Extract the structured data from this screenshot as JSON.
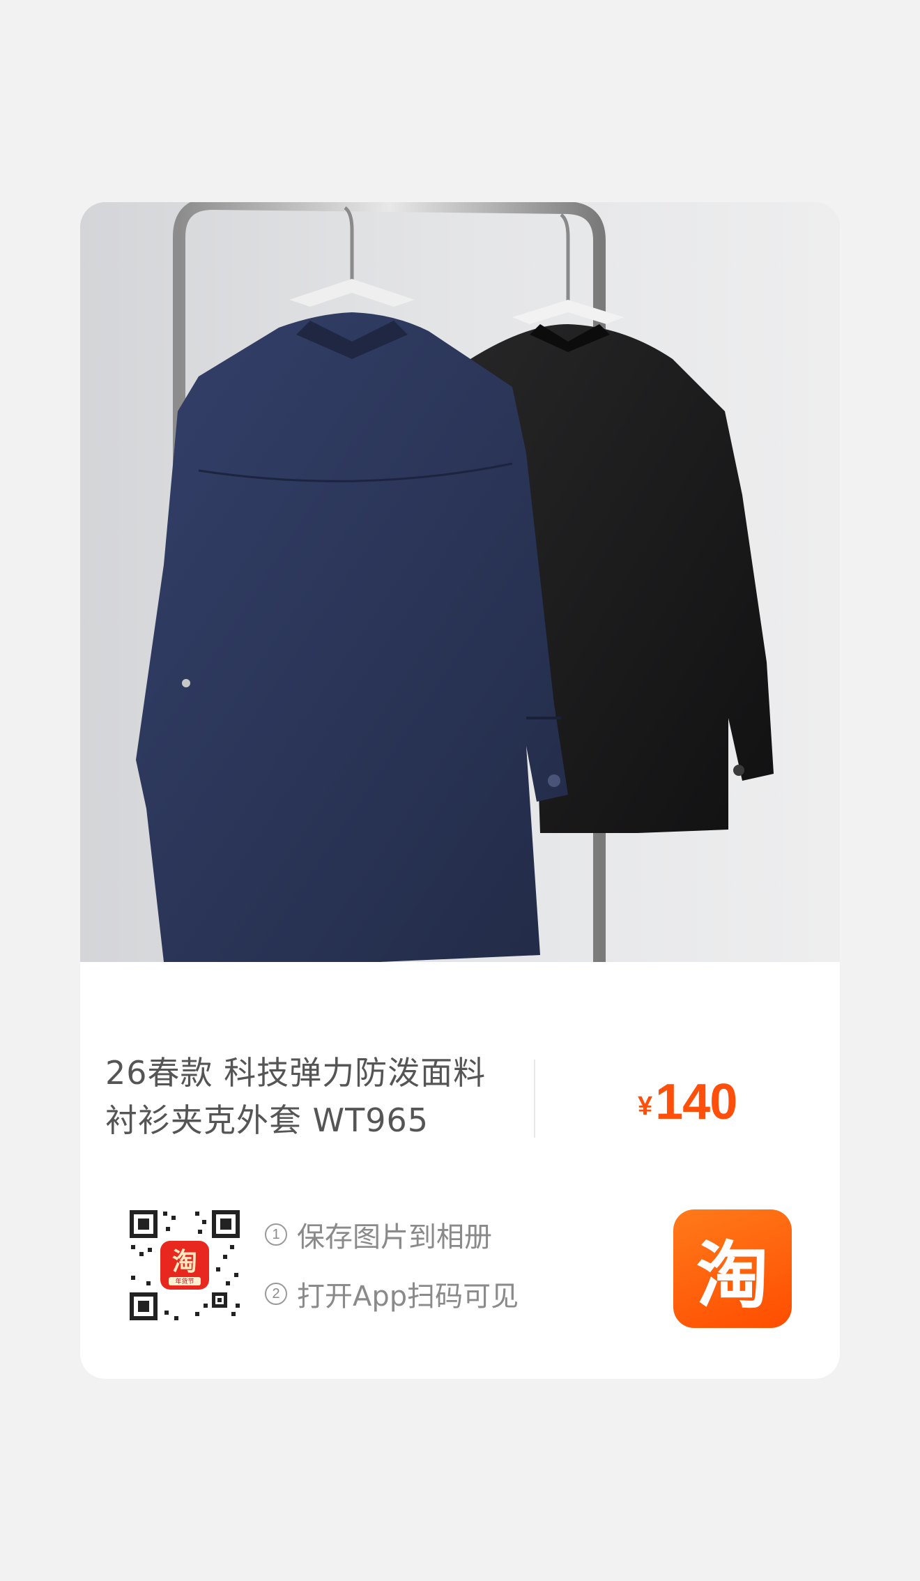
{
  "product": {
    "title_line1": "26春款 科技弹力防泼面料",
    "title_line2": "衬衫夹克外套 WT965",
    "currency": "¥",
    "price": "140"
  },
  "steps": [
    {
      "num": "1",
      "text": "保存图片到相册"
    },
    {
      "num": "2",
      "text": "打开App扫码可见"
    }
  ],
  "qr_badge": {
    "char": "淘",
    "sub": "年货节"
  },
  "logo": {
    "char": "淘"
  },
  "colors": {
    "price": "#ff4f0a",
    "logo_bg": "#ff5a0a",
    "background": "#f2f2f2",
    "navy_shirt": "#2b3556",
    "black_shirt": "#1b1b1c"
  },
  "icons": {
    "qr": "qr-code-icon",
    "logo": "taobao-logo-icon"
  }
}
